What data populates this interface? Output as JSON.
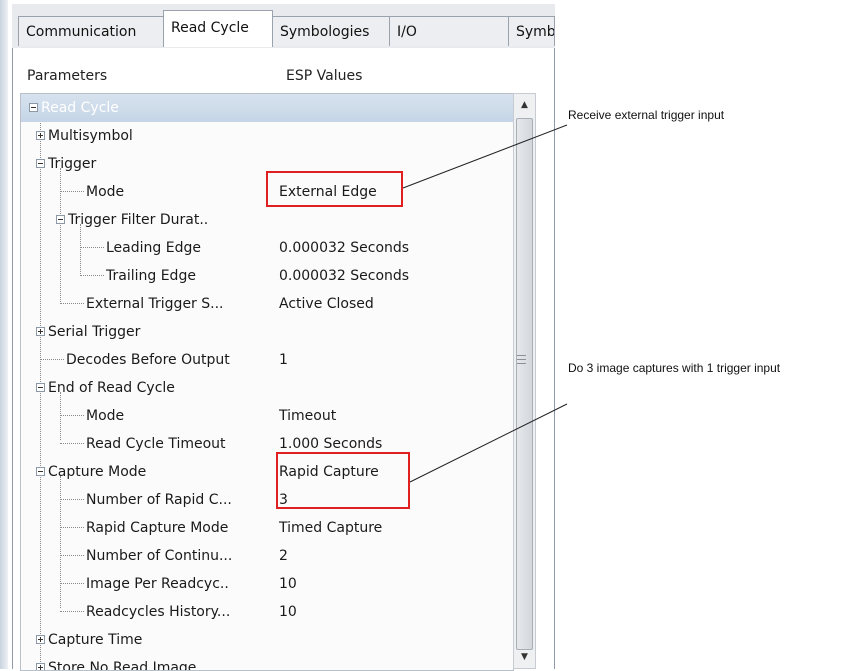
{
  "tabs": [
    "Communication",
    "Read Cycle",
    "Symbologies",
    "I/O",
    "Symb"
  ],
  "columns": {
    "parameters": "Parameters",
    "values": "ESP Values"
  },
  "tree": [
    {
      "label": "Read Cycle",
      "value": ""
    },
    {
      "label": "Multisymbol",
      "value": ""
    },
    {
      "label": "Trigger",
      "value": ""
    },
    {
      "label": "Mode",
      "value": "External Edge"
    },
    {
      "label": "Trigger Filter Durat..",
      "value": ""
    },
    {
      "label": "Leading Edge",
      "value": "0.000032 Seconds"
    },
    {
      "label": "Trailing Edge",
      "value": "0.000032 Seconds"
    },
    {
      "label": "External Trigger S...",
      "value": "Active Closed"
    },
    {
      "label": "Serial Trigger",
      "value": ""
    },
    {
      "label": "Decodes Before Output",
      "value": "1"
    },
    {
      "label": "End of Read Cycle",
      "value": ""
    },
    {
      "label": "Mode",
      "value": "Timeout"
    },
    {
      "label": "Read Cycle Timeout",
      "value": "1.000 Seconds"
    },
    {
      "label": "Capture Mode",
      "value": "Rapid Capture"
    },
    {
      "label": "Number of Rapid C...",
      "value": "3"
    },
    {
      "label": "Rapid Capture Mode",
      "value": "Timed Capture"
    },
    {
      "label": "Number of Continu...",
      "value": "2"
    },
    {
      "label": "Image Per Readcyc..",
      "value": "10"
    },
    {
      "label": "Readcycles History...",
      "value": "10"
    },
    {
      "label": "Capture Time",
      "value": ""
    },
    {
      "label": "Store No Read Image",
      "value": ""
    }
  ],
  "annotations": {
    "trigger": "Receive external trigger input",
    "capture": "Do 3 image captures with 1 trigger input"
  },
  "colors": {
    "highlight_box": "#e02020",
    "selected_row": "#c5d5e6"
  }
}
